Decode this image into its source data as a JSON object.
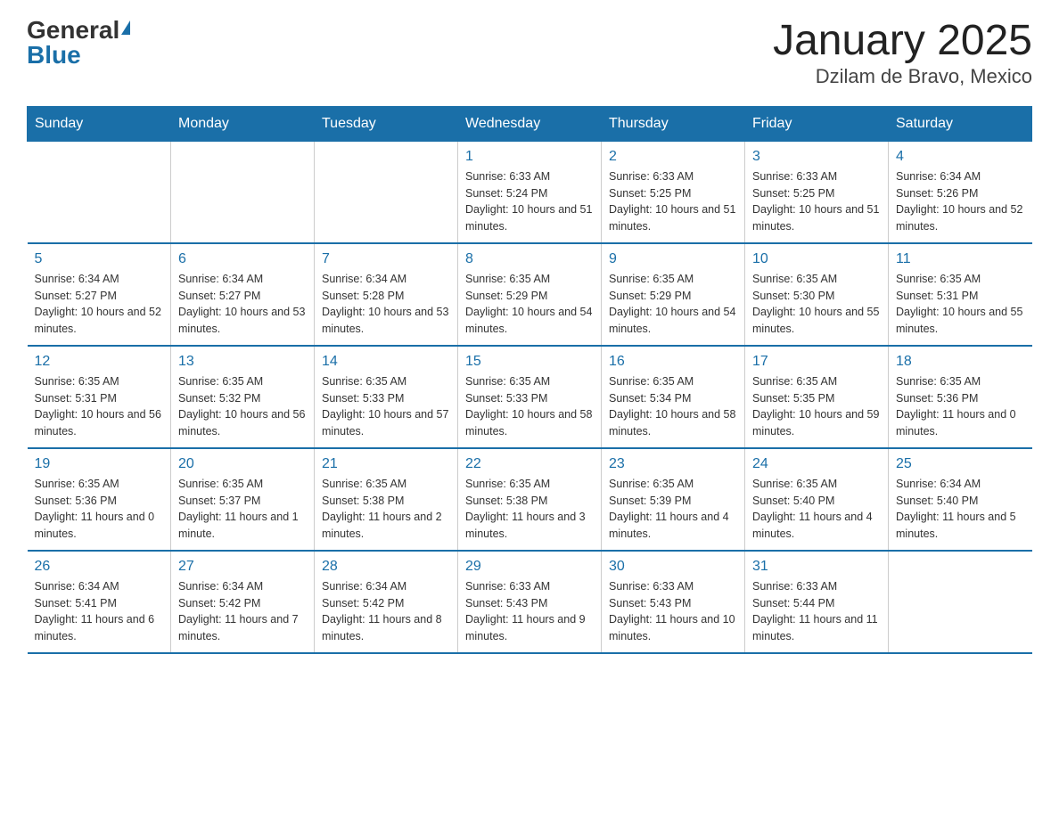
{
  "header": {
    "logo_general": "General",
    "logo_blue": "Blue",
    "title": "January 2025",
    "subtitle": "Dzilam de Bravo, Mexico"
  },
  "calendar": {
    "days_of_week": [
      "Sunday",
      "Monday",
      "Tuesday",
      "Wednesday",
      "Thursday",
      "Friday",
      "Saturday"
    ],
    "weeks": [
      [
        {
          "day": "",
          "info": ""
        },
        {
          "day": "",
          "info": ""
        },
        {
          "day": "",
          "info": ""
        },
        {
          "day": "1",
          "info": "Sunrise: 6:33 AM\nSunset: 5:24 PM\nDaylight: 10 hours and 51 minutes."
        },
        {
          "day": "2",
          "info": "Sunrise: 6:33 AM\nSunset: 5:25 PM\nDaylight: 10 hours and 51 minutes."
        },
        {
          "day": "3",
          "info": "Sunrise: 6:33 AM\nSunset: 5:25 PM\nDaylight: 10 hours and 51 minutes."
        },
        {
          "day": "4",
          "info": "Sunrise: 6:34 AM\nSunset: 5:26 PM\nDaylight: 10 hours and 52 minutes."
        }
      ],
      [
        {
          "day": "5",
          "info": "Sunrise: 6:34 AM\nSunset: 5:27 PM\nDaylight: 10 hours and 52 minutes."
        },
        {
          "day": "6",
          "info": "Sunrise: 6:34 AM\nSunset: 5:27 PM\nDaylight: 10 hours and 53 minutes."
        },
        {
          "day": "7",
          "info": "Sunrise: 6:34 AM\nSunset: 5:28 PM\nDaylight: 10 hours and 53 minutes."
        },
        {
          "day": "8",
          "info": "Sunrise: 6:35 AM\nSunset: 5:29 PM\nDaylight: 10 hours and 54 minutes."
        },
        {
          "day": "9",
          "info": "Sunrise: 6:35 AM\nSunset: 5:29 PM\nDaylight: 10 hours and 54 minutes."
        },
        {
          "day": "10",
          "info": "Sunrise: 6:35 AM\nSunset: 5:30 PM\nDaylight: 10 hours and 55 minutes."
        },
        {
          "day": "11",
          "info": "Sunrise: 6:35 AM\nSunset: 5:31 PM\nDaylight: 10 hours and 55 minutes."
        }
      ],
      [
        {
          "day": "12",
          "info": "Sunrise: 6:35 AM\nSunset: 5:31 PM\nDaylight: 10 hours and 56 minutes."
        },
        {
          "day": "13",
          "info": "Sunrise: 6:35 AM\nSunset: 5:32 PM\nDaylight: 10 hours and 56 minutes."
        },
        {
          "day": "14",
          "info": "Sunrise: 6:35 AM\nSunset: 5:33 PM\nDaylight: 10 hours and 57 minutes."
        },
        {
          "day": "15",
          "info": "Sunrise: 6:35 AM\nSunset: 5:33 PM\nDaylight: 10 hours and 58 minutes."
        },
        {
          "day": "16",
          "info": "Sunrise: 6:35 AM\nSunset: 5:34 PM\nDaylight: 10 hours and 58 minutes."
        },
        {
          "day": "17",
          "info": "Sunrise: 6:35 AM\nSunset: 5:35 PM\nDaylight: 10 hours and 59 minutes."
        },
        {
          "day": "18",
          "info": "Sunrise: 6:35 AM\nSunset: 5:36 PM\nDaylight: 11 hours and 0 minutes."
        }
      ],
      [
        {
          "day": "19",
          "info": "Sunrise: 6:35 AM\nSunset: 5:36 PM\nDaylight: 11 hours and 0 minutes."
        },
        {
          "day": "20",
          "info": "Sunrise: 6:35 AM\nSunset: 5:37 PM\nDaylight: 11 hours and 1 minute."
        },
        {
          "day": "21",
          "info": "Sunrise: 6:35 AM\nSunset: 5:38 PM\nDaylight: 11 hours and 2 minutes."
        },
        {
          "day": "22",
          "info": "Sunrise: 6:35 AM\nSunset: 5:38 PM\nDaylight: 11 hours and 3 minutes."
        },
        {
          "day": "23",
          "info": "Sunrise: 6:35 AM\nSunset: 5:39 PM\nDaylight: 11 hours and 4 minutes."
        },
        {
          "day": "24",
          "info": "Sunrise: 6:35 AM\nSunset: 5:40 PM\nDaylight: 11 hours and 4 minutes."
        },
        {
          "day": "25",
          "info": "Sunrise: 6:34 AM\nSunset: 5:40 PM\nDaylight: 11 hours and 5 minutes."
        }
      ],
      [
        {
          "day": "26",
          "info": "Sunrise: 6:34 AM\nSunset: 5:41 PM\nDaylight: 11 hours and 6 minutes."
        },
        {
          "day": "27",
          "info": "Sunrise: 6:34 AM\nSunset: 5:42 PM\nDaylight: 11 hours and 7 minutes."
        },
        {
          "day": "28",
          "info": "Sunrise: 6:34 AM\nSunset: 5:42 PM\nDaylight: 11 hours and 8 minutes."
        },
        {
          "day": "29",
          "info": "Sunrise: 6:33 AM\nSunset: 5:43 PM\nDaylight: 11 hours and 9 minutes."
        },
        {
          "day": "30",
          "info": "Sunrise: 6:33 AM\nSunset: 5:43 PM\nDaylight: 11 hours and 10 minutes."
        },
        {
          "day": "31",
          "info": "Sunrise: 6:33 AM\nSunset: 5:44 PM\nDaylight: 11 hours and 11 minutes."
        },
        {
          "day": "",
          "info": ""
        }
      ]
    ]
  }
}
